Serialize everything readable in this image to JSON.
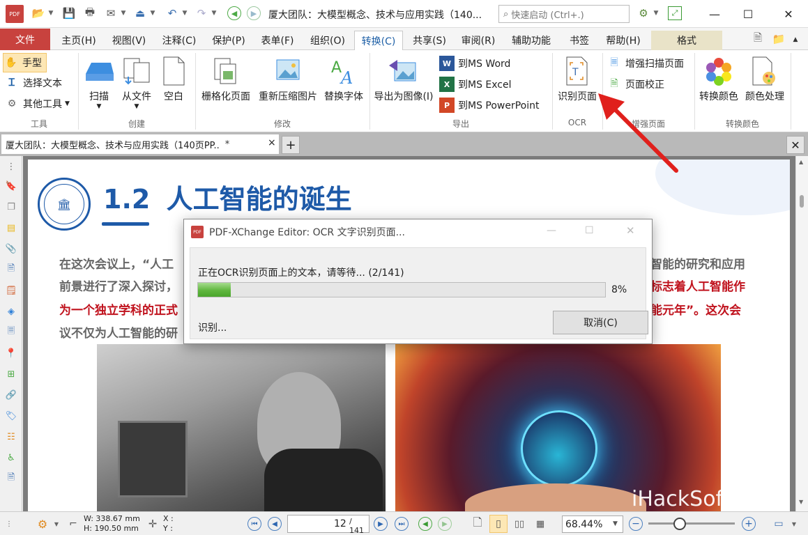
{
  "app": {
    "window_title": "厦大团队：大模型概念、技术与应用实践（140...",
    "search_placeholder": "快速启动 (Ctrl+.)"
  },
  "menu_tabs": [
    {
      "label": "文件"
    },
    {
      "label": "主页(H)"
    },
    {
      "label": "视图(V)"
    },
    {
      "label": "注释(C)"
    },
    {
      "label": "保护(P)"
    },
    {
      "label": "表单(F)"
    },
    {
      "label": "组织(O)"
    },
    {
      "label": "转换(C)"
    },
    {
      "label": "共享(S)"
    },
    {
      "label": "审阅(R)"
    },
    {
      "label": "辅助功能"
    },
    {
      "label": "书签"
    },
    {
      "label": "帮助(H)"
    },
    {
      "label": "格式"
    }
  ],
  "ribbon": {
    "tools": {
      "hand": "手型",
      "select_text": "选择文本",
      "other_tools": "其他工具",
      "label": "工具"
    },
    "create": {
      "scan": "扫描",
      "from_file": "从文件",
      "blank": "空白",
      "label": "创建"
    },
    "modify": {
      "rasterize": "栅格化页面",
      "recompress": "重新压缩图片",
      "replace_fonts": "替换字体",
      "label": "修改"
    },
    "export": {
      "export_image": "导出为图像(I)",
      "to_word": "到MS Word",
      "to_excel": "到MS Excel",
      "to_ppt": "到MS PowerPoint",
      "label": "导出"
    },
    "ocr": {
      "recognize": "识别页面",
      "label": "OCR"
    },
    "enhance": {
      "enhance_scan": "增强扫描页面",
      "page_correction": "页面校正",
      "label": "增强页面"
    },
    "convert_colors": {
      "convert": "转换颜色",
      "color_processing": "颜色处理",
      "label": "转换颜色"
    }
  },
  "doc_tab": {
    "title": "厦大团队：大模型概念、技术与应用实践（140页PP..",
    "modified": "*",
    "close": "×",
    "new_tab": "+"
  },
  "page": {
    "heading_num": "1.2",
    "heading_text": "人工智能的诞生",
    "p1_left": "在这次会议上，“人工",
    "p1_right": "智能的研究和应用",
    "p2_left": "前景进行了深入探讨，",
    "p2_right": "标志着人工智能作",
    "p3_left": "为一个独立学科的正式",
    "p3_right": "能元年”。这次会",
    "p4_left": "议不仅为人工智能的研"
  },
  "dialog": {
    "title": "PDF-XChange Editor: OCR 文字识别页面...",
    "message": "正在OCR识别页面上的文本，请等待... (2/141)",
    "progress_percent": 8,
    "percent_text": "8%",
    "status": "识别...",
    "cancel": "取消(C)"
  },
  "statusbar": {
    "width": "W: 338.67 mm",
    "height": "H: 190.50 mm",
    "x": "X :",
    "y": "Y :",
    "current_page": "12",
    "total_pages": "/ 141",
    "zoom": "68.44%"
  },
  "watermark": "iHackSoft.com",
  "colors": {
    "accent_red": "#c8423e",
    "link_blue": "#1d5fa6",
    "heading_blue": "#1e5aa8",
    "text_red": "#c0121d",
    "progress_green": "#5fb63e"
  }
}
